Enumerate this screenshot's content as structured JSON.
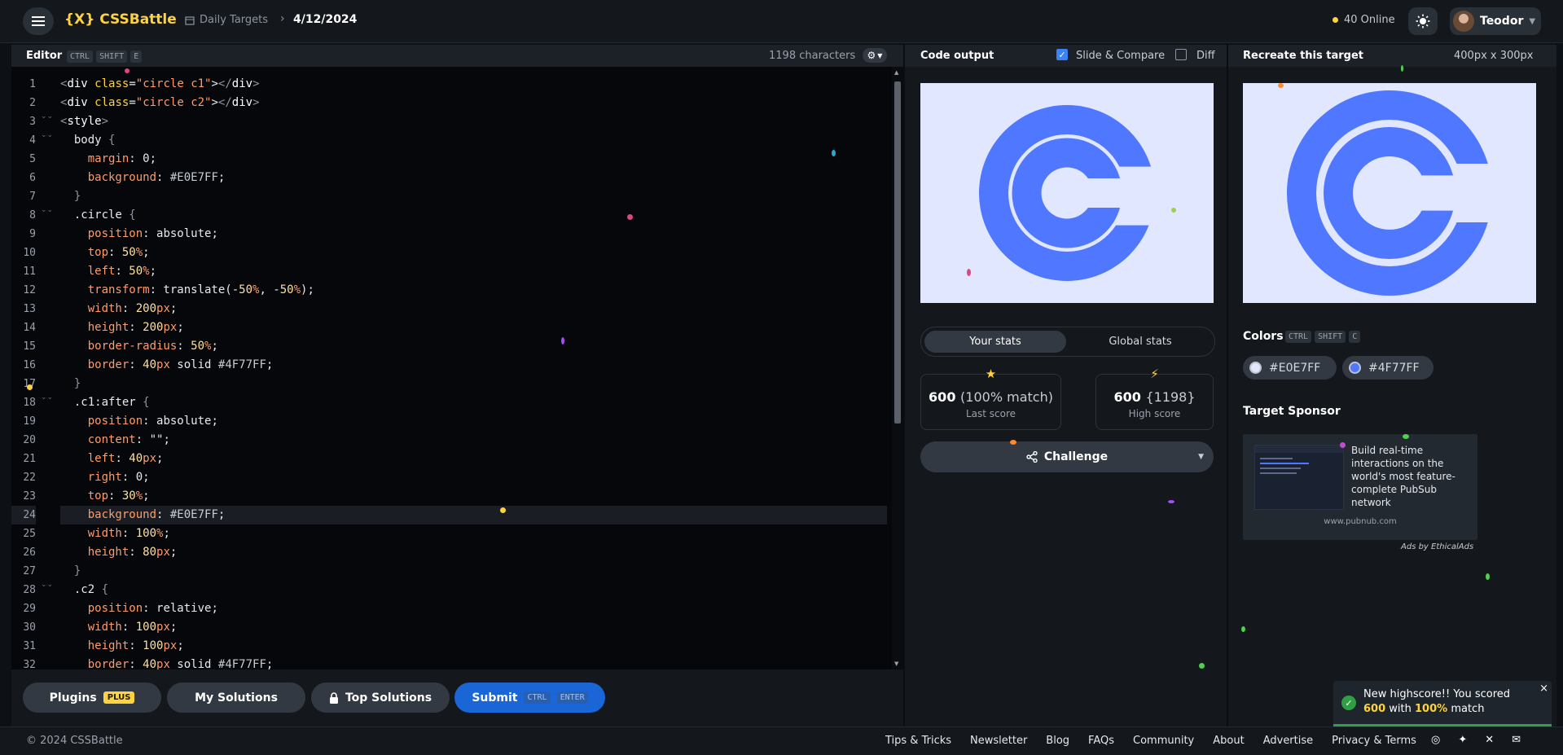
{
  "brand": "{X} CSSBattle",
  "breadcrumb": {
    "section": "Daily Targets",
    "current": "4/12/2024"
  },
  "online": "40 Online",
  "user": {
    "name": "Teodor"
  },
  "editor": {
    "title": "Editor",
    "shortcut": [
      "CTRL",
      "SHIFT",
      "E"
    ],
    "char_count": "1198 characters",
    "line_numbers": [
      "1",
      "2",
      "3",
      "4",
      "5",
      "6",
      "7",
      "8",
      "9",
      "10",
      "11",
      "12",
      "13",
      "14",
      "15",
      "16",
      "17",
      "18",
      "19",
      "20",
      "21",
      "22",
      "23",
      "24",
      "25",
      "26",
      "27",
      "28",
      "29",
      "30",
      "31",
      "32"
    ],
    "lines": [
      "<div class=\"circle c1\"></div>",
      "<div class=\"circle c2\"></div>",
      "<style>",
      "  body {",
      "    margin: 0;",
      "    background: #E0E7FF;",
      "  }",
      "  .circle {",
      "    position: absolute;",
      "    top: 50%;",
      "    left: 50%;",
      "    transform: translate(-50%, -50%);",
      "    width: 200px;",
      "    height: 200px;",
      "    border-radius: 50%;",
      "    border: 40px solid #4F77FF;",
      "  }",
      "  .c1:after {",
      "    position: absolute;",
      "    content: \"\";",
      "    left: 40px;",
      "    right: 0;",
      "    top: 30%;",
      "    background: #E0E7FF;",
      "    width: 100%;",
      "    height: 80px;",
      "  }",
      "  .c2 {",
      "    position: relative;",
      "    width: 100px;",
      "    height: 100px;",
      "    border: 40px solid #4F77FF;"
    ]
  },
  "buttons": {
    "plugins": "Plugins",
    "plugins_badge": "PLUS",
    "my_solutions": "My Solutions",
    "top_solutions": "Top Solutions",
    "submit": "Submit",
    "submit_keys": [
      "CTRL",
      "ENTER"
    ]
  },
  "output": {
    "title": "Code output",
    "slide_compare": "Slide & Compare",
    "diff": "Diff",
    "tabs": [
      "Your stats",
      "Global stats"
    ],
    "last_score": {
      "value": "600",
      "detail": "(100% match)",
      "label": "Last score"
    },
    "high_score": {
      "value": "600",
      "detail": "{1198}",
      "label": "High score"
    },
    "challenge": "Challenge"
  },
  "target": {
    "title": "Recreate this target",
    "size": "400px x 300px",
    "colors_title": "Colors",
    "colors_shortcut": [
      "CTRL",
      "SHIFT",
      "C"
    ],
    "colors": [
      {
        "hex": "#E0E7FF"
      },
      {
        "hex": "#4F77FF"
      }
    ],
    "sponsor_title": "Target Sponsor",
    "ad_text": "Build real-time interactions on the world's most feature-complete PubSub network",
    "ad_url": "www.pubnub.com",
    "ad_credit": "Ads by EthicalAds"
  },
  "toast": {
    "line1": "New highscore!! You scored",
    "score": "600",
    "with": "with",
    "match_value": "100%",
    "match_word": "match"
  },
  "footer": {
    "copyright": "© 2024 CSSBattle",
    "links": [
      "Tips & Tricks",
      "Newsletter",
      "Blog",
      "FAQs",
      "Community",
      "About",
      "Advertise",
      "Privacy & Terms"
    ]
  },
  "colors": {
    "accent": "#ffd23f",
    "target_bg": "#e0e7ff",
    "target_fg": "#4f77ff",
    "submit": "#1a66d6",
    "success": "#2ea043"
  }
}
